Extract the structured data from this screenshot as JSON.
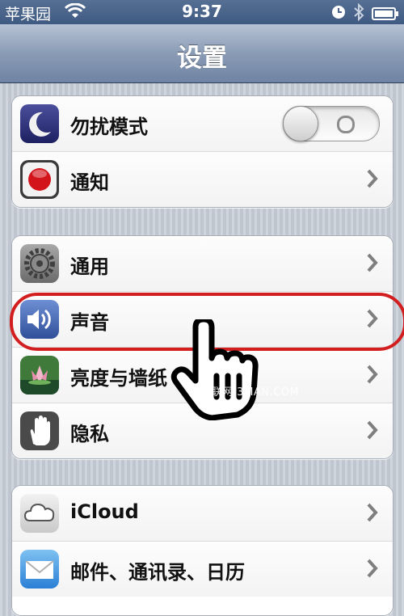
{
  "status_bar": {
    "carrier": "苹果园",
    "time": "9:37",
    "icons": [
      "wifi-icon",
      "clock-icon",
      "bluetooth-icon",
      "battery-icon"
    ]
  },
  "nav": {
    "title": "设置"
  },
  "groups": [
    {
      "items": [
        {
          "label": "勿扰模式",
          "icon": "moon-icon",
          "control": "toggle",
          "toggle_state": "off"
        },
        {
          "label": "通知",
          "icon": "notification-icon",
          "control": "chevron"
        }
      ]
    },
    {
      "items": [
        {
          "label": "通用",
          "icon": "gear-icon",
          "control": "chevron"
        },
        {
          "label": "声音",
          "icon": "speaker-icon",
          "control": "chevron",
          "highlighted": true
        },
        {
          "label": "亮度与墙纸",
          "icon": "wallpaper-icon",
          "control": "chevron"
        },
        {
          "label": "隐私",
          "icon": "hand-icon",
          "control": "chevron"
        }
      ]
    },
    {
      "items": [
        {
          "label": "iCloud",
          "icon": "cloud-icon",
          "control": "chevron"
        },
        {
          "label": "邮件、通讯录、日历",
          "icon": "mail-icon",
          "control": "chevron"
        }
      ]
    }
  ],
  "watermark": "三联网 3LIAN.COM",
  "colors": {
    "highlight": "#d21e1e",
    "navbar": "#8a9bb5"
  }
}
